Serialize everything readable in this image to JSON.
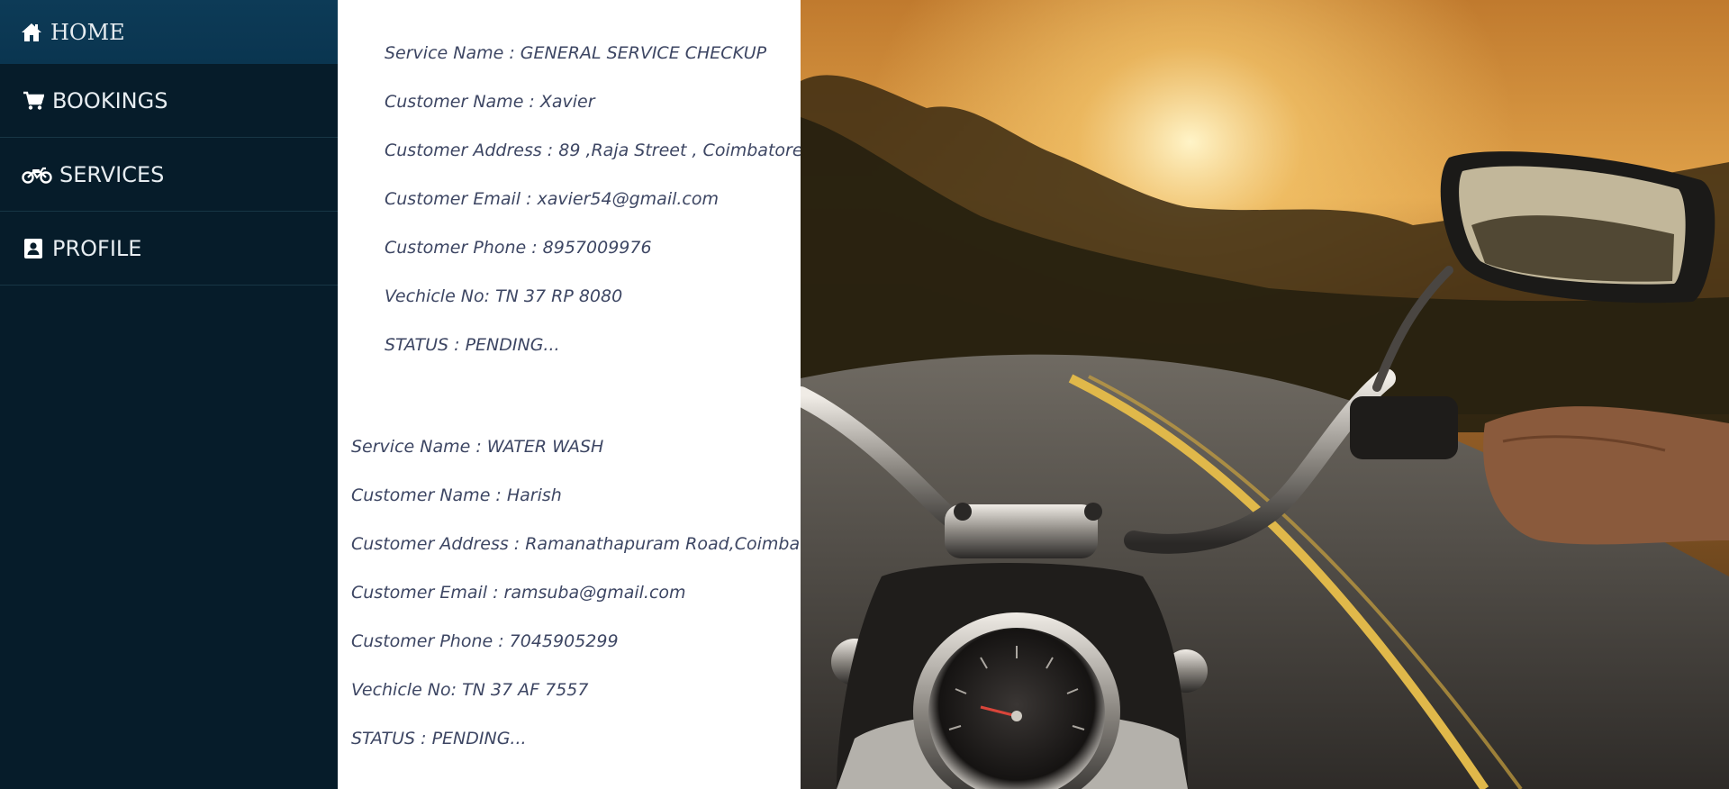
{
  "nav": {
    "items": [
      {
        "label": "HOME",
        "icon": "home-icon"
      },
      {
        "label": "BOOKINGS",
        "icon": "cart-icon"
      },
      {
        "label": "SERVICES",
        "icon": "motorcycle-icon"
      },
      {
        "label": "PROFILE",
        "icon": "address-book-icon"
      }
    ]
  },
  "bookings": [
    {
      "service": "Service Name : GENERAL SERVICE CHECKUP",
      "customer": "Customer Name : Xavier",
      "address": "Customer Address : 89 ,Raja Street , Coimbatore",
      "email": "Customer Email : xavier54@gmail.com",
      "phone": "Customer Phone : 8957009976",
      "vehicle": "Vechicle No: TN 37 RP 8080",
      "status": "STATUS : PENDING..."
    },
    {
      "service": "Service Name : WATER WASH",
      "customer": "Customer Name : Harish",
      "address": "Customer Address : Ramanathapuram Road,Coimbatore",
      "email": "Customer Email : ramsuba@gmail.com",
      "phone": "Customer Phone : 7045905299",
      "vehicle": "Vechicle No: TN 37 AF 7557",
      "status": "STATUS : PENDING..."
    }
  ],
  "colors": {
    "sidebar_bg": "#061c2a",
    "home_active_bg": "#0d3b57",
    "nav_text": "#e7edf1",
    "booking_text": "#3d4663"
  }
}
